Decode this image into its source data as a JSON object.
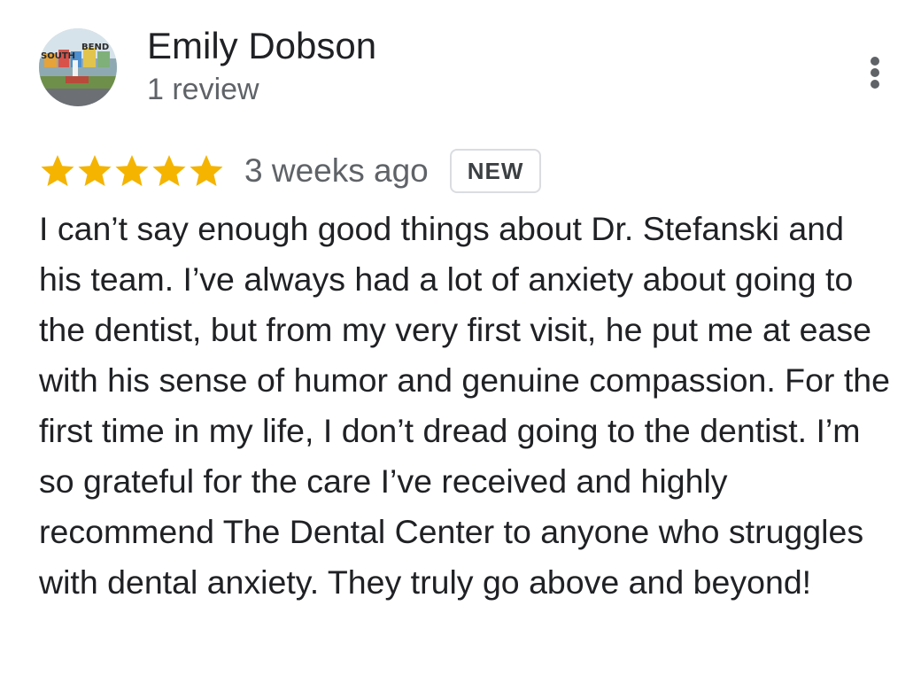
{
  "reviewer": {
    "name": "Emily Dobson",
    "review_count": "1 review",
    "avatar_text_left": "SOUTH",
    "avatar_text_right": "BEND"
  },
  "review": {
    "rating": 5,
    "max_rating": 5,
    "date": "3 weeks ago",
    "badge": "NEW",
    "text": "I can’t say enough good things about Dr. Stefanski and his team. I’ve always had a lot of anxiety about going to the dentist, but from my very first visit, he put me at ease with his sense of humor and genuine compassion. For the first time in my life, I don’t dread going to the dentist. I’m so grateful for the care I’ve received and highly recommend The Dental Center to anyone who struggles with dental anxiety. They truly go above and beyond!"
  },
  "icons": {
    "more": "more-vert-icon",
    "star": "star-icon"
  },
  "colors": {
    "star": "#f4b400",
    "name": "#202124",
    "secondary_text": "#5f6368",
    "badge_border": "#dadce0"
  }
}
